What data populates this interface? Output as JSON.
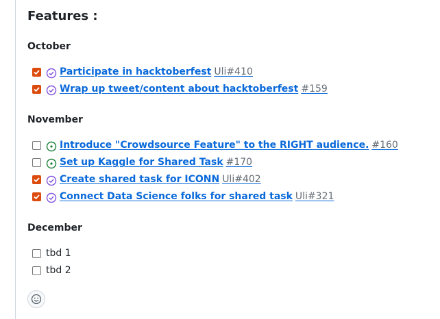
{
  "title": "Features :",
  "colors": {
    "checkbox_checked": "#dc4b0e",
    "link": "#0969da",
    "closed_purple": "#8250df",
    "open_green": "#1a7f37"
  },
  "sections": [
    {
      "heading": "October",
      "tasks": [
        {
          "checked": true,
          "state_icon": "issue-closed-icon",
          "title": "Participate in hacktoberfest",
          "ref": "Uli#410"
        },
        {
          "checked": true,
          "state_icon": "issue-closed-icon",
          "title": "Wrap up tweet/content about hacktoberfest",
          "ref": "#159"
        }
      ]
    },
    {
      "heading": "November",
      "tasks": [
        {
          "checked": false,
          "state_icon": "issue-open-icon",
          "title": "Introduce \"Crowdsource Feature\" to the RIGHT audience.",
          "ref": "#160"
        },
        {
          "checked": false,
          "state_icon": "issue-open-icon",
          "title": "Set up Kaggle for Shared Task",
          "ref": "#170"
        },
        {
          "checked": true,
          "state_icon": "issue-closed-icon",
          "title": "Create shared task for ICONN",
          "ref": "Uli#402"
        },
        {
          "checked": true,
          "state_icon": "issue-closed-icon",
          "title": "Connect Data Science folks for shared task",
          "ref": "Uli#321"
        }
      ]
    },
    {
      "heading": "December",
      "tasks": [
        {
          "checked": false,
          "label": "tbd 1"
        },
        {
          "checked": false,
          "label": "tbd 2"
        }
      ]
    }
  ],
  "reaction_button": {
    "icon": "smiley-icon"
  }
}
